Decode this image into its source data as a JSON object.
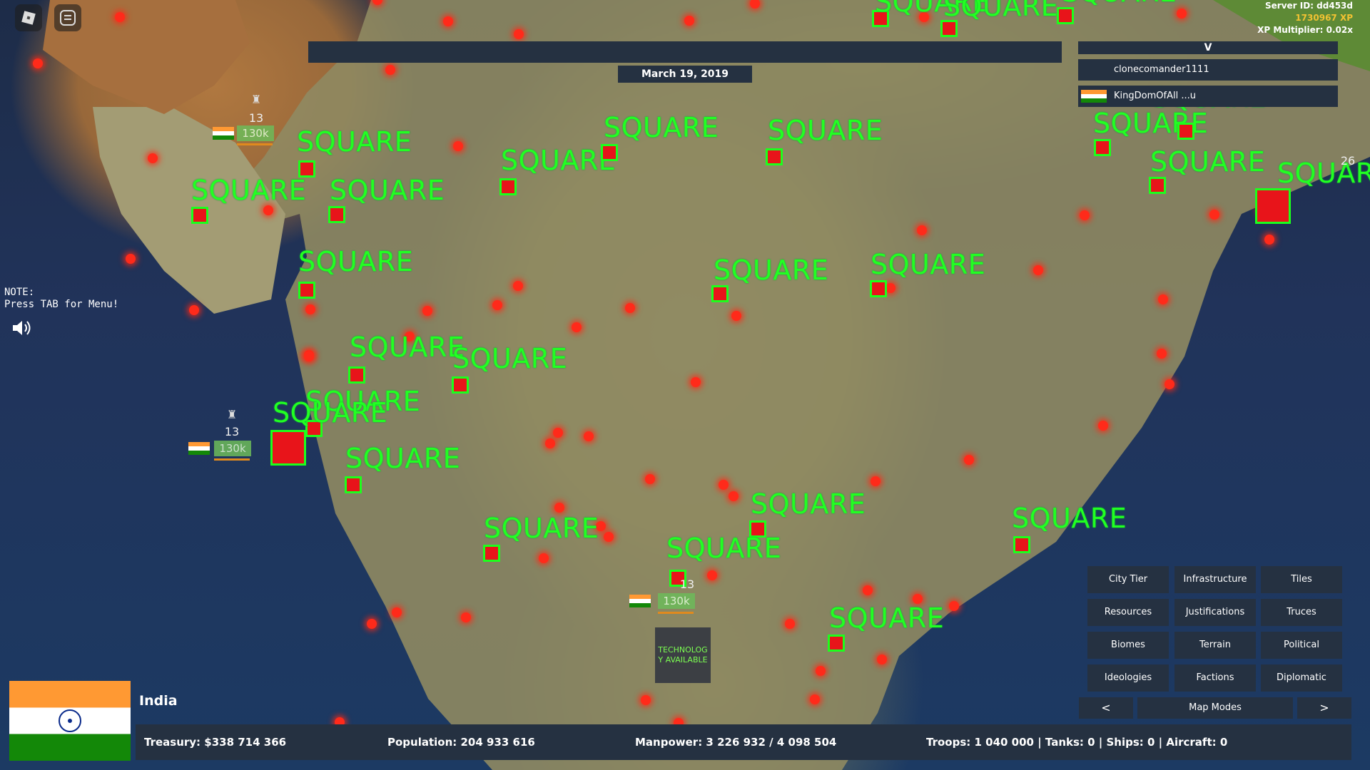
{
  "top_left": {
    "roblox_icon": "roblox-logo-icon",
    "menu_icon": "chat-menu-icon"
  },
  "server": {
    "id_line": "Server ID: dd453d",
    "xp_line": "1730967 XP",
    "mult_line": "XP Multiplier: 0.02x"
  },
  "date": "March 19, 2019",
  "players_panel": {
    "header": "V",
    "players": [
      "clonecomander1111",
      "KingDomOfAll ...u"
    ]
  },
  "note": "NOTE:\nPress TAB for Menu!",
  "tech": "TECHNOLOG\nY AVAILABLE",
  "marker_label": "SQUARE",
  "units": [
    {
      "count": "13",
      "strength": "130k"
    },
    {
      "count": "13",
      "strength": "130k"
    },
    {
      "count": "13",
      "strength": "130k"
    },
    {
      "count": "26",
      "strength": ""
    }
  ],
  "map_modes": {
    "buttons": [
      "City Tier",
      "Infrastructure",
      "Tiles",
      "Resources",
      "Justifications",
      "Truces",
      "Biomes",
      "Terrain",
      "Political",
      "Ideologies",
      "Factions",
      "Diplomatic"
    ],
    "prev": "<",
    "label": "Map Modes",
    "next": ">"
  },
  "country": {
    "name": "India",
    "treasury": "Treasury:  $338 714 366",
    "population": "Population: 204 933 616",
    "manpower": "Manpower:  3 226 932  /  4 098 504",
    "military": "Troops: 1 040 000  |  Tanks: 0  |  Ships: 0  |  Aircraft: 0"
  },
  "colors": {
    "panel": "#253141",
    "marker_green": "#22ff22",
    "city_red": "#ff2a1a",
    "xp_gold": "#f2c232"
  }
}
